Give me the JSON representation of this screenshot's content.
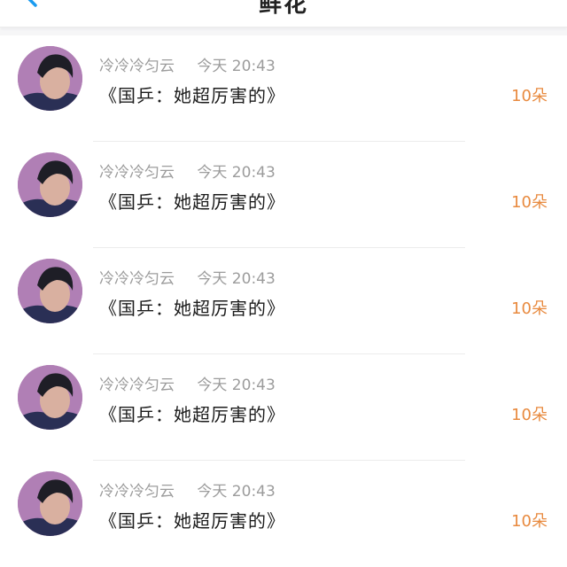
{
  "header": {
    "title": "鲜花",
    "back_icon": "chevron-left-icon"
  },
  "colors": {
    "accent": "#e88a3f",
    "back_button": "#1a9bf0",
    "meta_text": "#9c9c9c"
  },
  "gifts": [
    {
      "sender": "冷冷冷匀云",
      "time": "今天 20:43",
      "message": "《国乒：她超厉害的》",
      "amount": "10朵"
    },
    {
      "sender": "冷冷冷匀云",
      "time": "今天 20:43",
      "message": "《国乒：她超厉害的》",
      "amount": "10朵"
    },
    {
      "sender": "冷冷冷匀云",
      "time": "今天 20:43",
      "message": "《国乒：她超厉害的》",
      "amount": "10朵"
    },
    {
      "sender": "冷冷冷匀云",
      "time": "今天 20:43",
      "message": "《国乒：她超厉害的》",
      "amount": "10朵"
    },
    {
      "sender": "冷冷冷匀云",
      "time": "今天 20:43",
      "message": "《国乒：她超厉害的》",
      "amount": "10朵"
    }
  ]
}
